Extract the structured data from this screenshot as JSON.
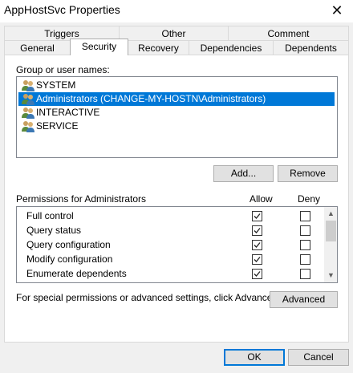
{
  "window": {
    "title": "AppHostSvc Properties",
    "close_glyph": "✕"
  },
  "tabs_row1": [
    {
      "label": "Triggers"
    },
    {
      "label": "Other"
    },
    {
      "label": "Comment"
    }
  ],
  "tabs_row2": [
    {
      "label": "General"
    },
    {
      "label": "Security",
      "active": true
    },
    {
      "label": "Recovery"
    },
    {
      "label": "Dependencies"
    },
    {
      "label": "Dependents"
    }
  ],
  "groups": {
    "label": "Group or user names:",
    "items": [
      {
        "name": "SYSTEM",
        "icon": "users-icon"
      },
      {
        "name": "Administrators (CHANGE-MY-HOSTN\\Administrators)",
        "icon": "users-icon",
        "selected": true
      },
      {
        "name": "INTERACTIVE",
        "icon": "users-icon"
      },
      {
        "name": "SERVICE",
        "icon": "users-icon"
      }
    ]
  },
  "buttons": {
    "add": "Add...",
    "remove": "Remove",
    "advanced": "Advanced",
    "ok": "OK",
    "cancel": "Cancel"
  },
  "permissions": {
    "label": "Permissions for Administrators",
    "allow_header": "Allow",
    "deny_header": "Deny",
    "rows": [
      {
        "name": "Full control",
        "allow": true,
        "deny": false
      },
      {
        "name": "Query status",
        "allow": true,
        "deny": false
      },
      {
        "name": "Query configuration",
        "allow": true,
        "deny": false
      },
      {
        "name": "Modify configuration",
        "allow": true,
        "deny": false
      },
      {
        "name": "Enumerate dependents",
        "allow": true,
        "deny": false
      },
      {
        "name": "",
        "allow": true,
        "deny": false
      }
    ]
  },
  "advanced_note": "For special permissions or advanced settings, click Advanced.",
  "colors": {
    "selection": "#0078d7",
    "window_bg": "#f0f0f0",
    "panel_bg": "#ffffff"
  }
}
